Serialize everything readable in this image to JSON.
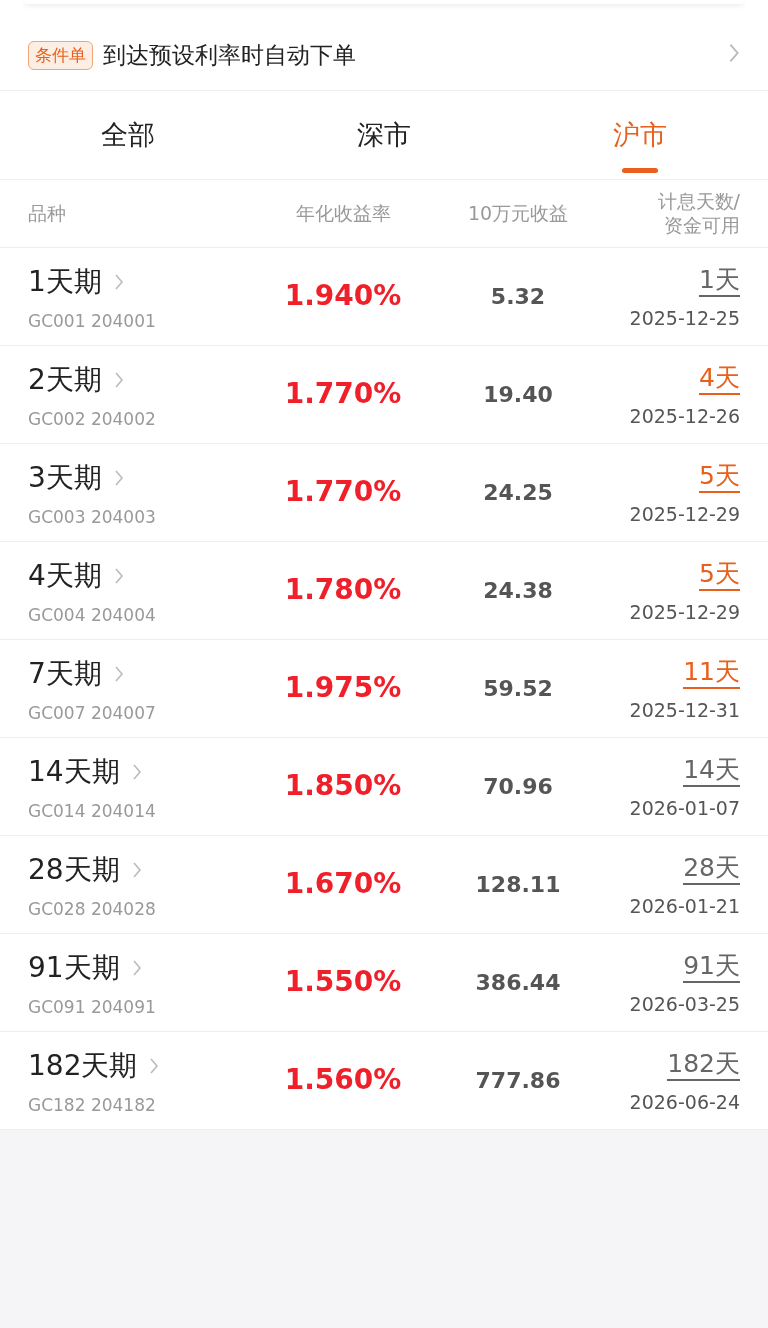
{
  "condition_banner": {
    "tag": "条件单",
    "text": "到达预设利率时自动下单"
  },
  "tabs": [
    {
      "label": "全部",
      "selected": false
    },
    {
      "label": "深市",
      "selected": false
    },
    {
      "label": "沪市",
      "selected": true
    }
  ],
  "table": {
    "columns": [
      "品种",
      "年化收益率",
      "10万元收益",
      "计息天数/\n资金可用"
    ],
    "rows": [
      {
        "name": "1天期",
        "code": "GC001 204001",
        "rate": "1.940%",
        "income": "5.32",
        "days": "1天",
        "highlight": false,
        "date": "2025-12-25"
      },
      {
        "name": "2天期",
        "code": "GC002 204002",
        "rate": "1.770%",
        "income": "19.40",
        "days": "4天",
        "highlight": true,
        "date": "2025-12-26"
      },
      {
        "name": "3天期",
        "code": "GC003 204003",
        "rate": "1.770%",
        "income": "24.25",
        "days": "5天",
        "highlight": true,
        "date": "2025-12-29"
      },
      {
        "name": "4天期",
        "code": "GC004 204004",
        "rate": "1.780%",
        "income": "24.38",
        "days": "5天",
        "highlight": true,
        "date": "2025-12-29"
      },
      {
        "name": "7天期",
        "code": "GC007 204007",
        "rate": "1.975%",
        "income": "59.52",
        "days": "11天",
        "highlight": true,
        "date": "2025-12-31"
      },
      {
        "name": "14天期",
        "code": "GC014 204014",
        "rate": "1.850%",
        "income": "70.96",
        "days": "14天",
        "highlight": false,
        "date": "2026-01-07"
      },
      {
        "name": "28天期",
        "code": "GC028 204028",
        "rate": "1.670%",
        "income": "128.11",
        "days": "28天",
        "highlight": false,
        "date": "2026-01-21"
      },
      {
        "name": "91天期",
        "code": "GC091 204091",
        "rate": "1.550%",
        "income": "386.44",
        "days": "91天",
        "highlight": false,
        "date": "2026-03-25"
      },
      {
        "name": "182天期",
        "code": "GC182 204182",
        "rate": "1.560%",
        "income": "777.86",
        "days": "182天",
        "highlight": false,
        "date": "2026-06-24"
      }
    ]
  }
}
